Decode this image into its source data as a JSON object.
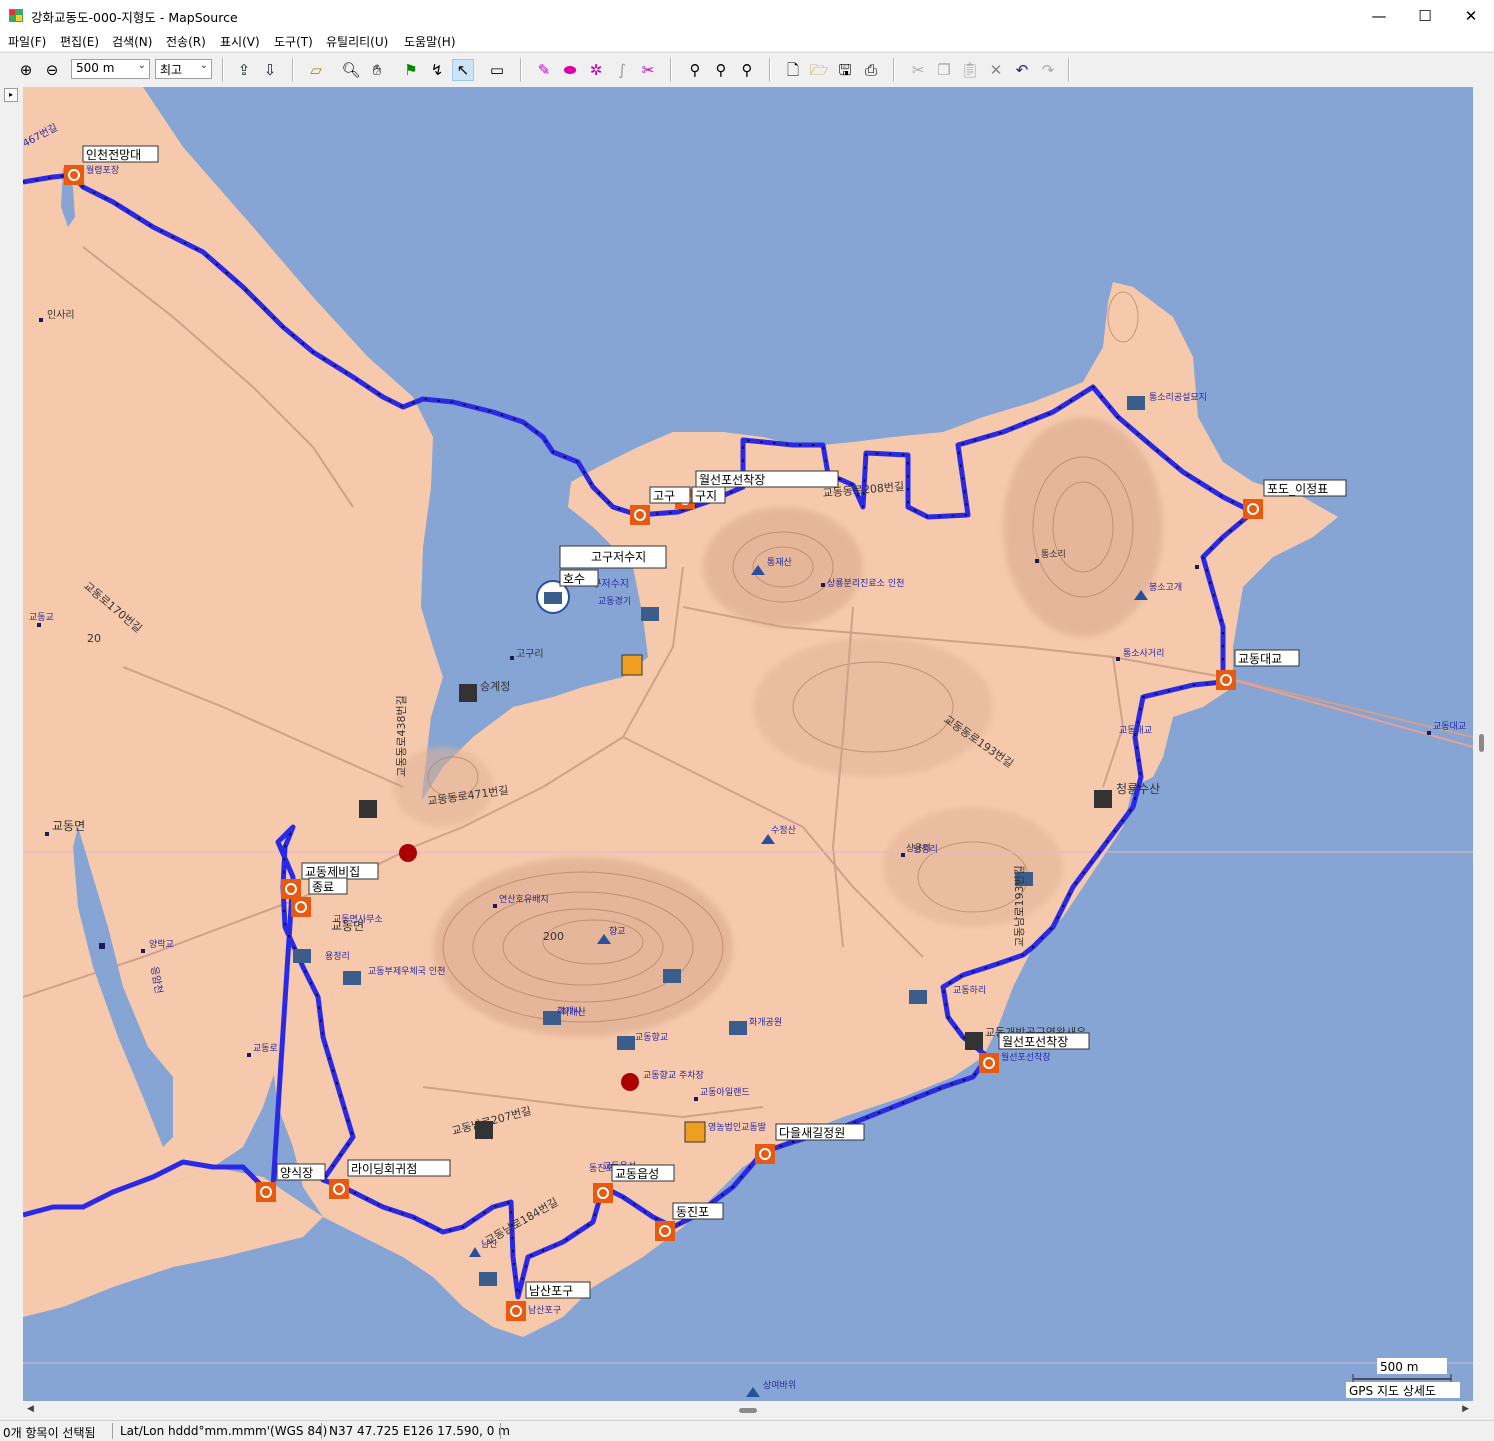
{
  "window": {
    "title": "강화교동도-000-지형도 - MapSource",
    "minimize": "—",
    "maximize": "☐",
    "close": "✕"
  },
  "menu": [
    "파일(F)",
    "편집(E)",
    "검색(N)",
    "전송(R)",
    "표시(V)",
    "도구(T)",
    "유틸리티(U)",
    "도움말(H)"
  ],
  "toolbar": {
    "scale_value": "500 m",
    "detail_value": "최고",
    "icons": [
      "zoom-in-icon",
      "zoom-out-icon",
      "receive-from-device-icon",
      "send-to-device-icon",
      "selection-tool-icon",
      "zoom-tool-icon",
      "hand-tool-icon",
      "waypoint-tool-icon",
      "route-tool-icon",
      "pointer-tool-icon",
      "measure-distance-icon",
      "track-color-icon",
      "eraser-icon",
      "route-recalc-icon",
      "track-join-icon",
      "track-divide-icon",
      "find-icon",
      "find-nearby-icon",
      "find-route-icon",
      "new-file-icon",
      "open-file-icon",
      "save-file-icon",
      "print-icon",
      "cut-icon",
      "copy-icon",
      "paste-icon",
      "delete-icon",
      "undo-icon",
      "redo-icon"
    ]
  },
  "map": {
    "colors": {
      "water": "#86a5d4",
      "land": "#f6c9ad",
      "track": "#2a2ae6",
      "road": "#c9a492"
    },
    "waypoint_labels": [
      "인천전망대",
      "고구",
      "구지",
      "월선포선착장",
      "고구저수지",
      "호수",
      "교동제비집",
      "종료",
      "포도_이정표",
      "교동대교",
      "다을새길정원",
      "양식장",
      "라이딩회귀점",
      "교동읍성",
      "동진포",
      "남산포구",
      "월선포선착장"
    ],
    "place_labels": [
      "467번길",
      "월령포장",
      "인사리",
      "고구리",
      "승계정",
      "교동면",
      "교동면",
      "교동로170번길",
      "20",
      "교동동로438번길",
      "교동동로471번길",
      "교동남로207번길",
      "교동남로184번길",
      "교동동로193번길",
      "교동남로193번길",
      "교동동로208번길",
      "고구저수지",
      "화개산",
      "연산호유배지",
      "200",
      "향교",
      "교동향교",
      "교동향교 주차장",
      "교동아일랜드",
      "영농법인교동딸",
      "남산",
      "남산포구",
      "동진포",
      "교동읍성",
      "양락교",
      "교동로",
      "화개사",
      "화개공원",
      "상용리",
      "용정리",
      "청룡수산",
      "통소리공설묘지",
      "통소리",
      "봉소고개",
      "통소사거리",
      "교동대교",
      "교동개방공구역왕새우",
      "월선포선착장",
      "응암천",
      "통재산",
      "상룡분리진료소 인천",
      "교동하리",
      "교동부제우체국 인천",
      "교동면사무소",
      "상여바위",
      "수정산",
      "난정리",
      "교동교",
      "교동경기",
      "교동대교"
    ],
    "scale_bar": "500 m",
    "map_name": "GPS 지도 상세도"
  },
  "status": {
    "selection": "0개 항목이 선택됨",
    "coord_format": "Lat/Lon hddd°mm.mmm'(WGS 84)",
    "position": "N37 47.725 E126 17.590, 0 m"
  }
}
